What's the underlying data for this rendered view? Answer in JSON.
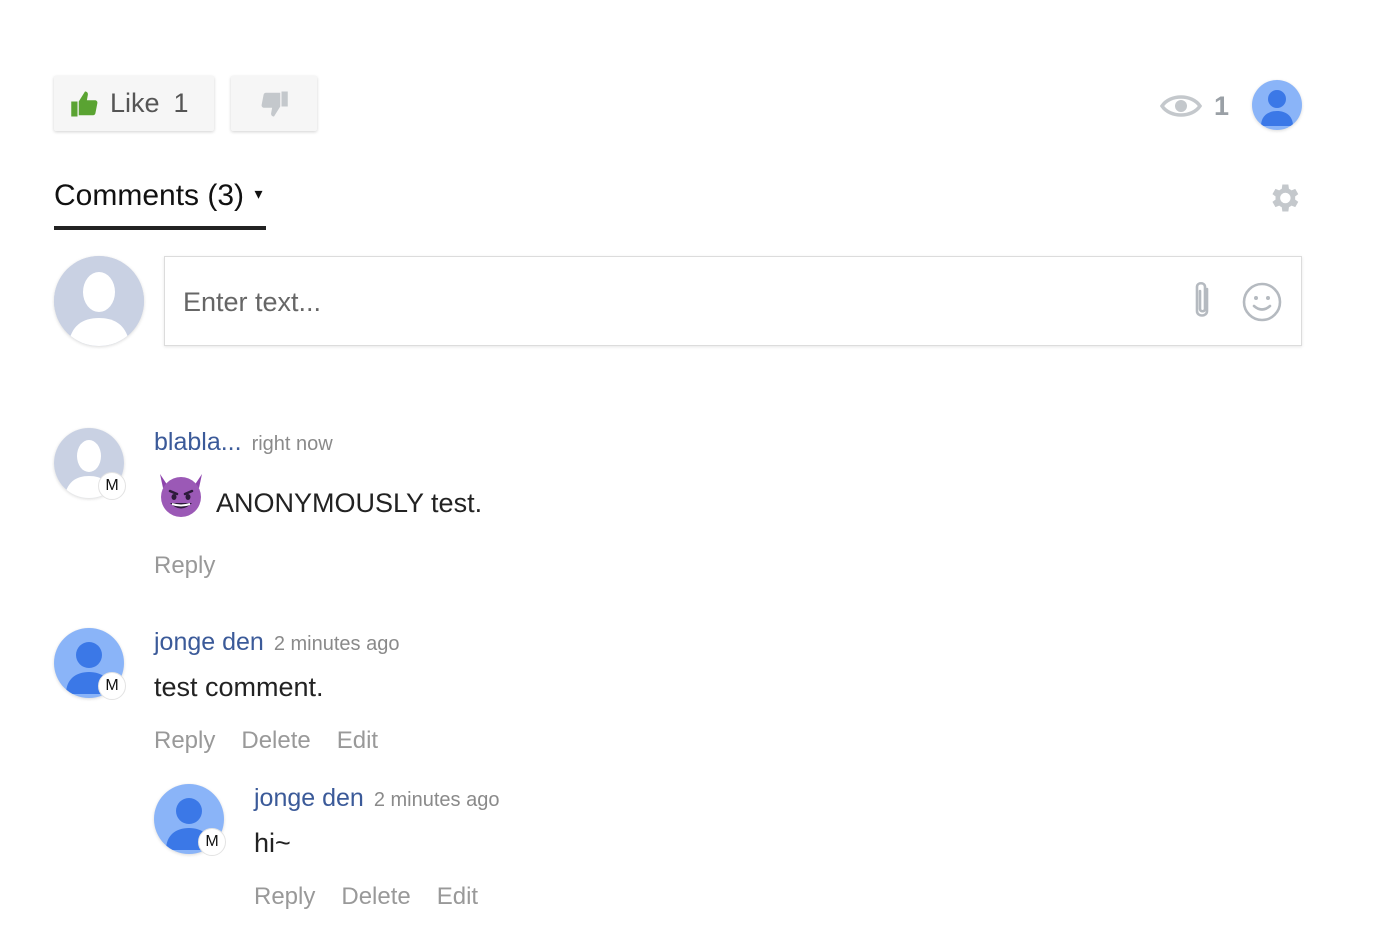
{
  "reactions": {
    "like_label": "Like",
    "like_count": "1",
    "views_count": "1"
  },
  "comments_header": {
    "title": "Comments (3)",
    "caret": "▾"
  },
  "composer": {
    "placeholder": "Enter text..."
  },
  "colors": {
    "like_green": "#5aa332",
    "author_blue": "#3b5a99",
    "avatar_blue": "#8ab4f8",
    "avatar_person": "#3b78e7",
    "anon_avatar": "#c9d1e3",
    "muted_gray": "#999999"
  },
  "comments": [
    {
      "author": "blabla...",
      "time": "right now",
      "badge": "M",
      "avatar": "anonymous",
      "emoji_icon": "smiling-devil-emoji",
      "text": "ANONYMOUSLY test.",
      "actions": [
        "Reply"
      ]
    },
    {
      "author": "jonge den",
      "time": "2 minutes ago",
      "badge": "M",
      "avatar": "user",
      "text": "test comment.",
      "actions": [
        "Reply",
        "Delete",
        "Edit"
      ]
    },
    {
      "author": "jonge den",
      "time": "2 minutes ago",
      "badge": "M",
      "avatar": "user",
      "text": "hi~",
      "actions": [
        "Reply",
        "Delete",
        "Edit"
      ]
    }
  ]
}
